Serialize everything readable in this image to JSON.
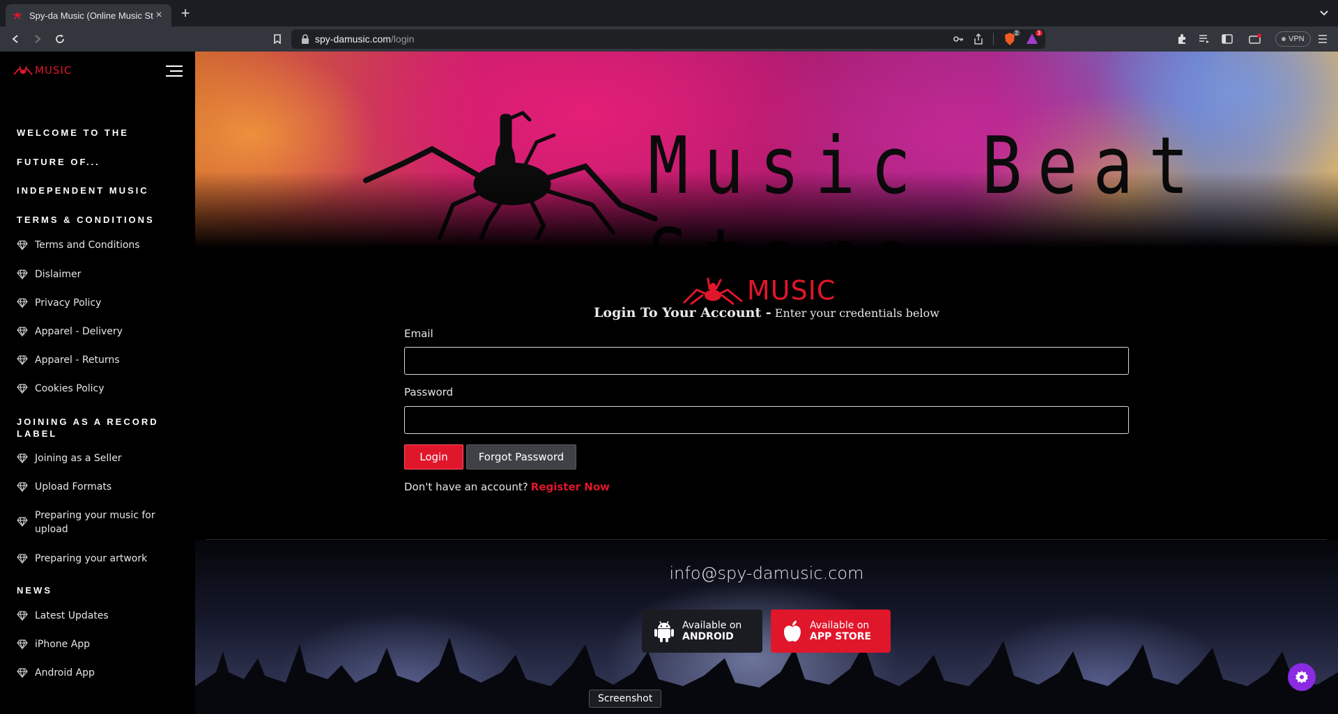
{
  "browser": {
    "tab_title": "Spy-da Music (Online Music Str",
    "url_host": "spy-damusic.com",
    "url_path": "/login",
    "brave_badge": "2",
    "alert_badge": "3",
    "vpn_label": "VPN"
  },
  "sidebar": {
    "logo_text": "MUSIC",
    "sections": [
      {
        "title": "WELCOME TO THE"
      },
      {
        "title": "FUTURE OF..."
      },
      {
        "title": "INDEPENDENT MUSIC"
      },
      {
        "title": "TERMS & CONDITIONS"
      },
      {
        "title": "JOINING AS A RECORD LABEL"
      },
      {
        "title": "NEWS"
      }
    ],
    "items": [
      {
        "label": "Terms and Conditions"
      },
      {
        "label": "Dislaimer"
      },
      {
        "label": "Privacy Policy"
      },
      {
        "label": "Apparel - Delivery"
      },
      {
        "label": "Apparel - Returns"
      },
      {
        "label": "Cookies Policy"
      },
      {
        "label": "Joining as a Seller"
      },
      {
        "label": "Upload Formats"
      },
      {
        "label": "Preparing your music for upload"
      },
      {
        "label": "Preparing your artwork"
      },
      {
        "label": "Latest Updates"
      },
      {
        "label": "iPhone App"
      },
      {
        "label": "Android App"
      }
    ]
  },
  "hero": {
    "title": "Music Beat Store"
  },
  "login": {
    "logo_text": "MUSIC",
    "heading_bold": "Login To Your Account -",
    "heading_sub": "Enter your credentials below",
    "email_label": "Email",
    "email_value": "",
    "password_label": "Password",
    "password_value": "",
    "login_button": "Login",
    "forgot_button": "Forgot Password",
    "no_account_text": "Don't have an account?",
    "register_link": "Register Now"
  },
  "footer": {
    "email": "info@spy-damusic.com",
    "android": {
      "line1": "Available on",
      "line2": "ANDROID"
    },
    "apple": {
      "line1": "Available on",
      "line2": "APP STORE"
    }
  },
  "tooltip": "Screenshot",
  "colors": {
    "brand_red": "#e0162b",
    "background": "#000000",
    "fab_purple": "#8a2be2"
  },
  "icons": [
    "back-icon",
    "forward-icon",
    "reload-icon",
    "bookmark-icon",
    "lock-icon",
    "key-icon",
    "share-icon",
    "brave-shield-icon",
    "brave-rewards-icon",
    "extensions-icon",
    "playlist-icon",
    "sidebar-toggle-icon",
    "wallet-icon",
    "menu-icon",
    "hamburger-icon",
    "diamond-icon",
    "android-icon",
    "apple-icon",
    "gear-icon"
  ]
}
